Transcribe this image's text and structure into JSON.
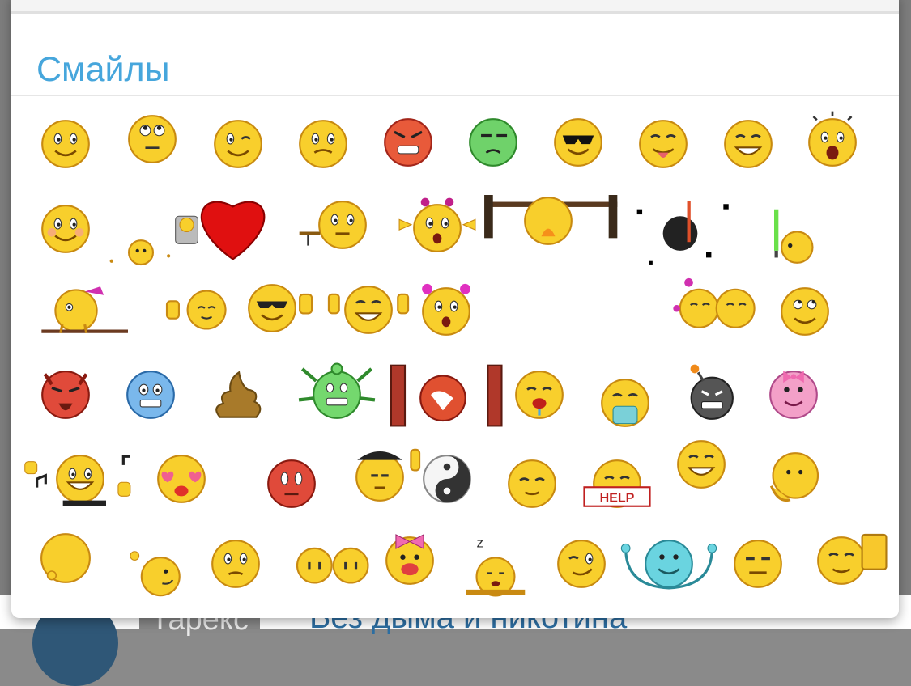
{
  "modal": {
    "title": "Смайлы"
  },
  "background_page": {
    "author_label": "Тарекс",
    "thread_link": "Без дыма и никотина"
  },
  "colors": {
    "title_blue": "#46a6dc",
    "smiley_yellow": "#f8cf2c",
    "link_blue": "#2d6fa3"
  },
  "smileys": [
    "smile",
    "rolling-eyes",
    "wink",
    "scared",
    "angry",
    "sick-green",
    "cool-sunglasses",
    "tongue",
    "big-grin",
    "shocked",
    "blush",
    "bouncing",
    "heart",
    "waiter",
    "dancer-ears",
    "barbell-fire",
    "ninja-swords",
    "lightsaber",
    "bow-cowboy",
    "thumbs-down",
    "sunglasses-thumbs-up",
    "double-thumbs-up",
    "girl-surprised",
    "kissing-pair",
    "rolling-eyes-2",
    "devil",
    "frozen",
    "poop",
    "alien",
    "head-wall",
    "crying",
    "tissue",
    "bomb",
    "pink-pig",
    "music-dance",
    "heart-eyes",
    "red-embarrassed",
    "middle-finger",
    "yin-yang",
    "satisfied",
    "help-sign",
    "happy-face",
    "thinking",
    "ball",
    "sideways",
    "shy",
    "clapping",
    "pink-bow",
    "sleeping",
    "smirk",
    "hug-blue",
    "neutral",
    "beer"
  ]
}
